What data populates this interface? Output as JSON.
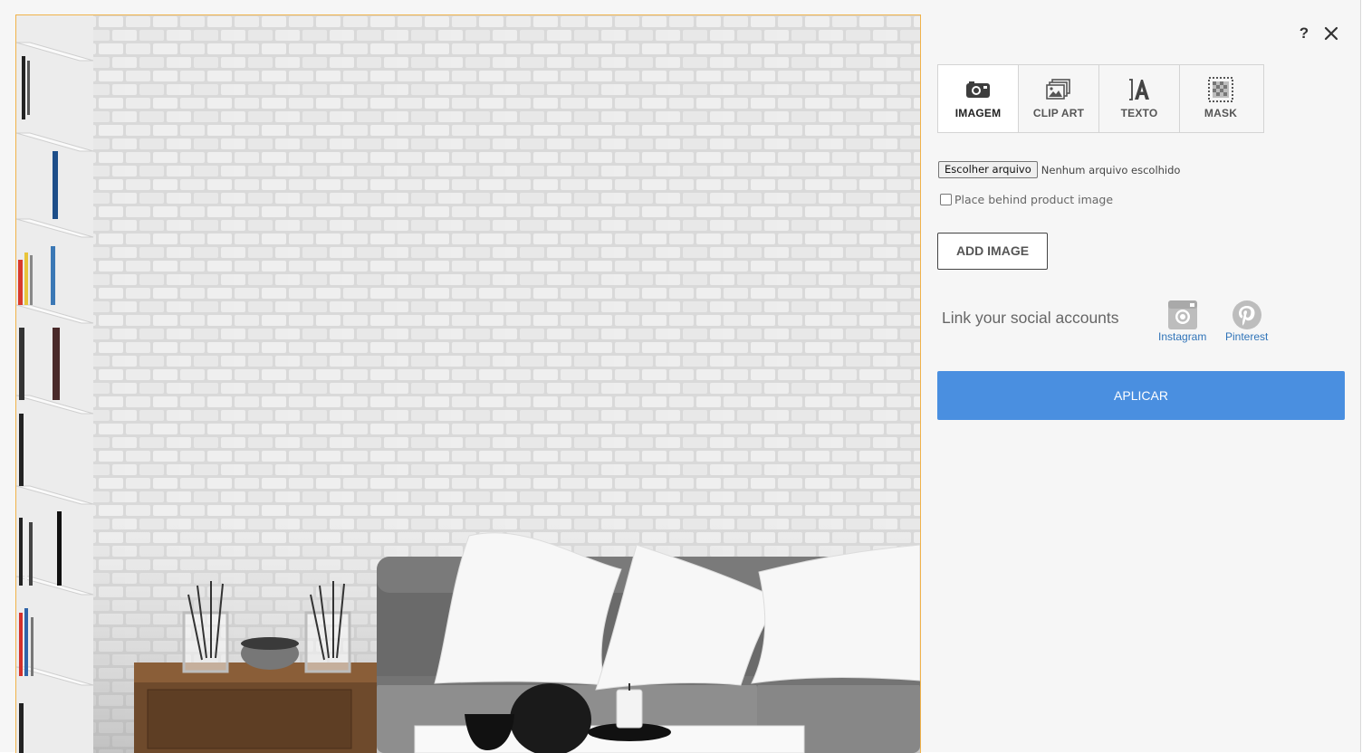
{
  "window": {
    "help_label": "?",
    "close_icon": "close-icon"
  },
  "tabs": [
    {
      "label": "IMAGEM",
      "icon": "camera-icon",
      "active": true
    },
    {
      "label": "CLIP ART",
      "icon": "images-icon",
      "active": false
    },
    {
      "label": "TEXTO",
      "icon": "text-icon",
      "active": false
    },
    {
      "label": "MASK",
      "icon": "mask-icon",
      "active": false
    }
  ],
  "upload": {
    "choose_file_label": "Escolher arquivo",
    "file_status": "Nenhum arquivo escolhido",
    "behind_checkbox_label": "Place behind product image",
    "behind_checked": false,
    "add_image_label": "ADD IMAGE"
  },
  "social": {
    "title": "Link your social accounts",
    "accounts": [
      {
        "label": "Instagram",
        "icon": "instagram-icon"
      },
      {
        "label": "Pinterest",
        "icon": "pinterest-icon"
      }
    ]
  },
  "apply_label": "APLICAR",
  "colors": {
    "accent": "#4a8fe0",
    "link": "#2f73b8",
    "canvas_border": "#f0b24a",
    "panel_bg": "#f6f6f6"
  }
}
